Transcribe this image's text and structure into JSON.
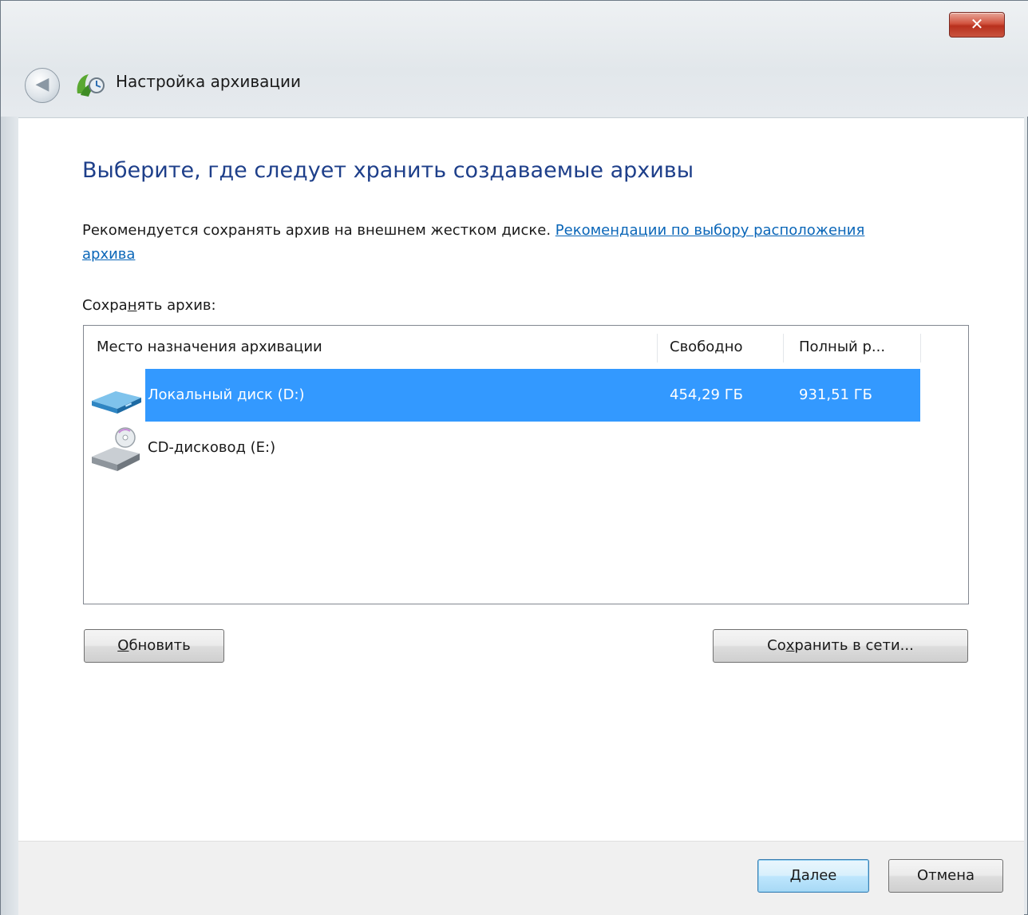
{
  "window": {
    "title": "Настройка архивации",
    "close_symbol": "✕",
    "back_symbol": "◀"
  },
  "page": {
    "heading": "Выберите, где следует хранить создаваемые архивы",
    "description_text": "Рекомендуется сохранять архив на внешнем жестком диске. ",
    "description_link": "Рекомендации по выбору расположения архива",
    "save_label_prefix": "Сохра",
    "save_label_accel": "н",
    "save_label_suffix": "ять архив:"
  },
  "list": {
    "columns": [
      "Место назначения архивации",
      "Свободно",
      "Полный р..."
    ],
    "rows": [
      {
        "name": "Локальный диск (D:)",
        "free": "454,29 ГБ",
        "total": "931,51 ГБ",
        "icon": "hard-drive-icon",
        "selected": true
      },
      {
        "name": "CD-дисковод (E:)",
        "free": "",
        "total": "",
        "icon": "cd-drive-icon",
        "selected": false
      }
    ]
  },
  "buttons": {
    "refresh_accel": "О",
    "refresh_rest": "бновить",
    "save_network_prefix": "Со",
    "save_network_accel": "х",
    "save_network_rest": "ранить в сети...",
    "next_accel": "Д",
    "next_rest": "алее",
    "cancel": "Отмена"
  },
  "colors": {
    "selection": "#3399ff",
    "heading": "#1e3f8a",
    "link": "#0a66b8",
    "close_button": "#c9412c"
  }
}
